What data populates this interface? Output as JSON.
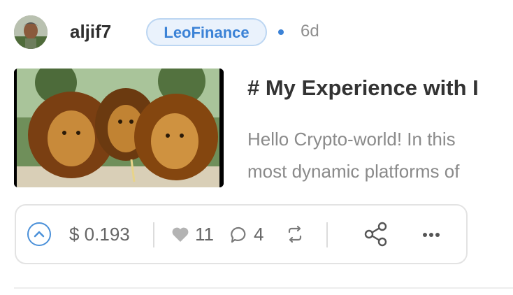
{
  "post": {
    "author": "aljif7",
    "community": "LeoFinance",
    "age": "6d",
    "title": "# My Experience with I",
    "excerpt_lines": [
      "Hello Crypto-world! In this",
      "most dynamic platforms of"
    ],
    "thumbnail_icon": "lions-image"
  },
  "actions": {
    "payout": "$ 0.193",
    "likes": "11",
    "comments": "4"
  },
  "colors": {
    "accent": "#3b82d6",
    "badge_bg": "#eaf2fc",
    "muted_text": "#8a8a8a"
  }
}
